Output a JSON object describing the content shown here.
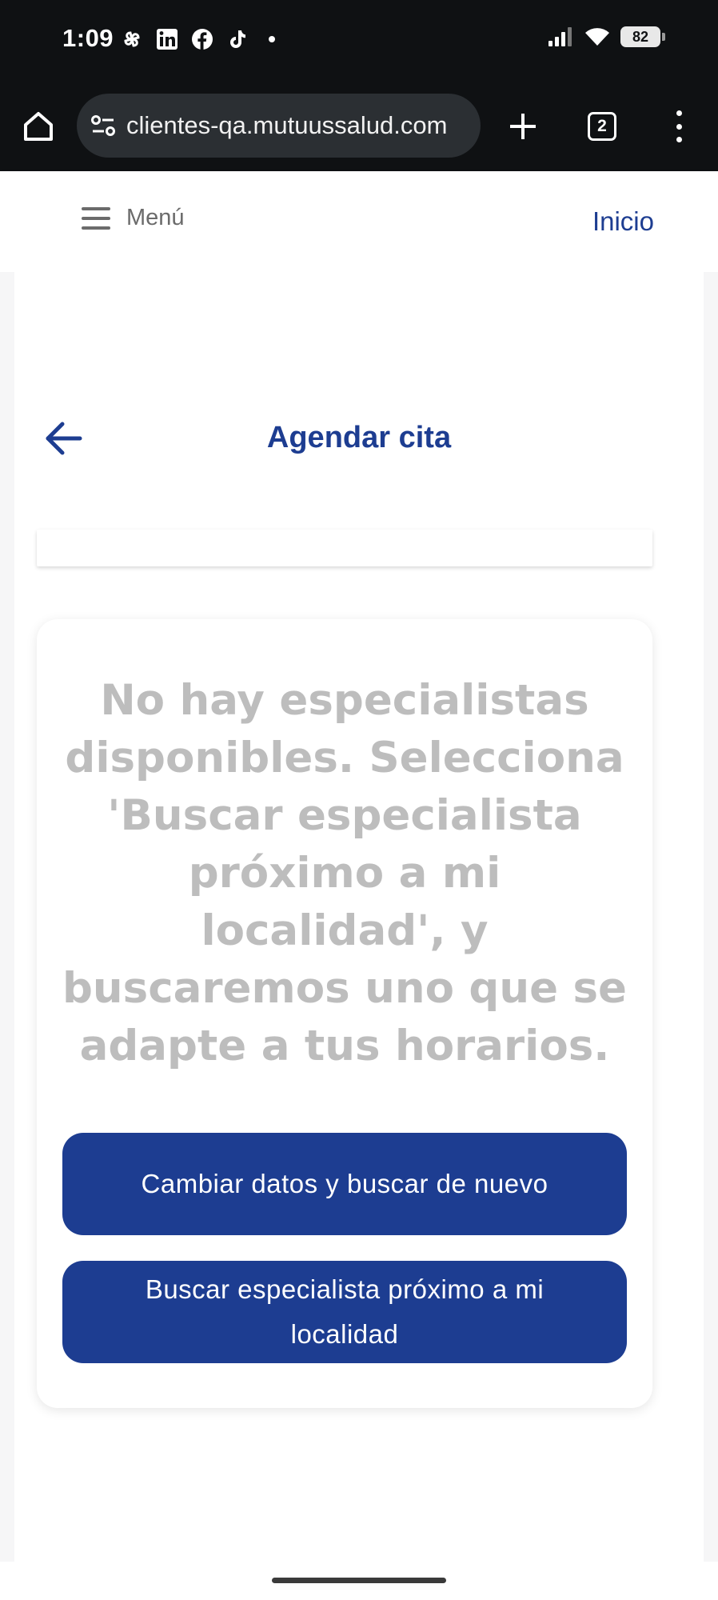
{
  "status_bar": {
    "time": "1:09",
    "battery": "82",
    "notification_icons": [
      "pinwheel-icon",
      "linkedin-icon",
      "facebook-icon",
      "tiktok-icon"
    ]
  },
  "browser": {
    "url": "clientes-qa.mutuussalud.com",
    "tab_count": "2"
  },
  "header": {
    "menu_label": "Menú",
    "home_link": "Inicio"
  },
  "page": {
    "title": "Agendar cita",
    "empty_message": "No hay especialistas disponibles. Selecciona 'Buscar especialista próximo a mi localidad', y buscaremos uno que se adapte a tus horarios.",
    "buttons": {
      "change_search": "Cambiar datos y buscar de nuevo",
      "search_nearby": "Buscar especialista próximo a mi localidad"
    }
  },
  "colors": {
    "primary": "#1d3d91",
    "muted_text": "#bdbdbd",
    "browser_chrome": "#0f1113"
  }
}
